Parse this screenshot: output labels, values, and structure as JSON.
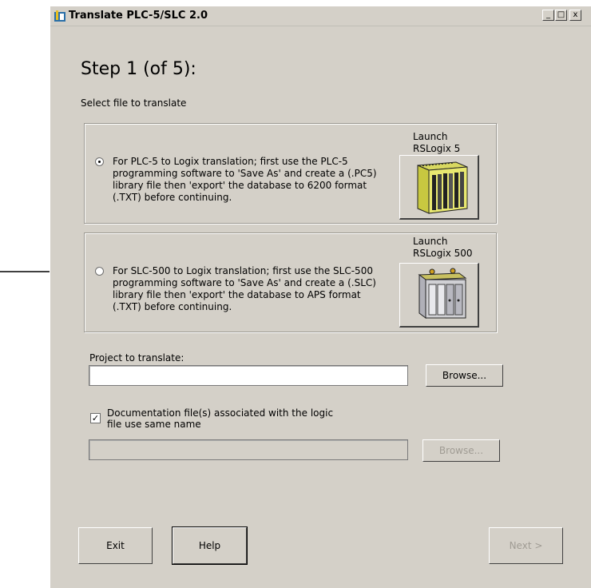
{
  "window": {
    "title": "Translate PLC-5/SLC 2.0",
    "controls": {
      "minimize": "_",
      "maximize": "□",
      "close": "x"
    }
  },
  "step": {
    "title": "Step 1 (of 5):",
    "subtitle": "Select file to translate"
  },
  "options": [
    {
      "selected": true,
      "lines": [
        "For PLC-5 to Logix translation; first use the PLC-5",
        "programming software to 'Save As' and create a (.PC5)",
        "library file then 'export' the database to 6200 format",
        "(.TXT) before continuing."
      ],
      "launch_label_1": "Launch",
      "launch_label_2": "RSLogix 5",
      "launch_icon": "plc5-chassis-icon"
    },
    {
      "selected": false,
      "lines": [
        "For SLC-500 to Logix translation; first use the SLC-500",
        "programming software to 'Save As' and create a (.SLC)",
        "library file then 'export' the database to APS format",
        "(.TXT) before continuing."
      ],
      "launch_label_1": "Launch",
      "launch_label_2": "RSLogix 500",
      "launch_icon": "slc500-chassis-icon"
    }
  ],
  "project": {
    "label": "Project to translate:",
    "value": "",
    "browse_label": "Browse..."
  },
  "documentation": {
    "checked": true,
    "label_line1": "Documentation file(s) associated with the logic",
    "label_line2": "file use same name",
    "value": "",
    "browse_label": "Browse..."
  },
  "buttons": {
    "exit": "Exit",
    "help": "Help",
    "next": "Next >"
  }
}
